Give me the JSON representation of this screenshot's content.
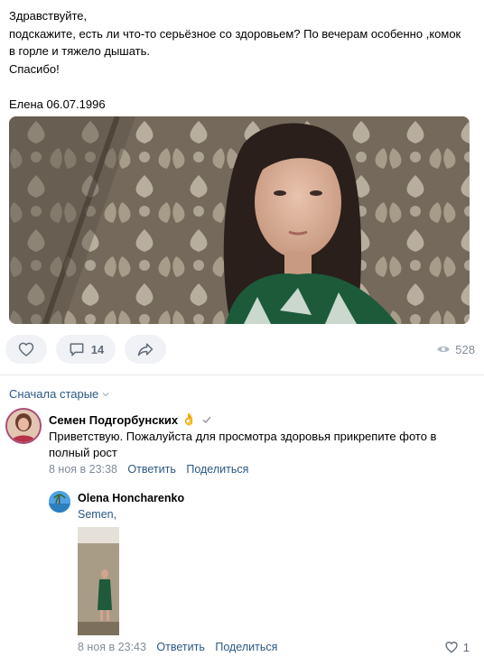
{
  "post": {
    "lines": [
      "Здравствуйте,",
      "подскажите, есть ли что-то серьёзное со здоровьем? По вечерам особенно ,комок",
      "в горле и тяжело дышать.",
      "Спасибо!",
      "",
      "Елена 06.07.1996"
    ]
  },
  "actions": {
    "comments_count": "14",
    "views_count": "528"
  },
  "sort": {
    "label": "Сначала старые"
  },
  "comment": {
    "author": "Семен Подгорбунских",
    "emoji": "👌",
    "text": "Приветствую. Пожалуйста для просмотра здоровья прикрепите фото в полный рост",
    "time": "8 ноя в 23:38",
    "reply_label": "Ответить",
    "share_label": "Поделиться"
  },
  "reply": {
    "author": "Olena Honcharenko",
    "mention": "Semen,",
    "time": "8 ноя в 23:43",
    "reply_label": "Ответить",
    "share_label": "Поделиться",
    "likes": "1"
  },
  "colors": {
    "link": "#2a5885",
    "muted": "#818c99",
    "pill_bg": "#f0f2f5",
    "divider": "#e7e8ec"
  }
}
